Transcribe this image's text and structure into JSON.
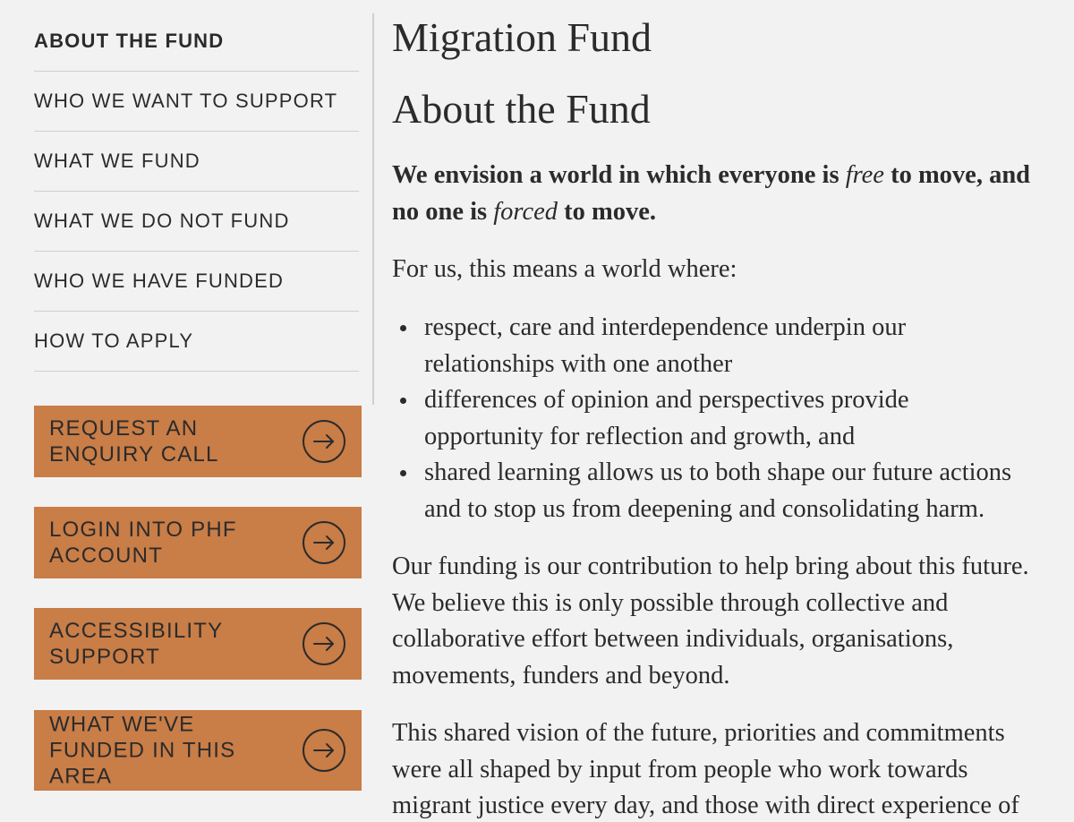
{
  "sidebar": {
    "nav": [
      {
        "label": "ABOUT THE FUND",
        "active": true
      },
      {
        "label": "WHO WE WANT TO SUPPORT"
      },
      {
        "label": "WHAT WE FUND"
      },
      {
        "label": "WHAT WE DO NOT FUND"
      },
      {
        "label": "WHO WE HAVE FUNDED"
      },
      {
        "label": "HOW TO APPLY"
      }
    ],
    "cta": [
      {
        "lines": [
          "REQUEST AN",
          "ENQUIRY CALL"
        ],
        "icon": "arrow-right-circle-icon"
      },
      {
        "lines": [
          "LOGIN INTO PHF",
          "ACCOUNT"
        ],
        "icon": "arrow-right-circle-icon"
      },
      {
        "lines": [
          "ACCESSIBILITY",
          "SUPPORT"
        ],
        "icon": "arrow-right-circle-icon"
      },
      {
        "lines": [
          "WHAT WE'VE",
          "FUNDED IN THIS",
          "AREA"
        ],
        "icon": "arrow-right-circle-icon"
      }
    ]
  },
  "main": {
    "page_title": "Migration Fund",
    "section_title": "About the Fund",
    "vision": {
      "line1_a": "We envision a world in which everyone is ",
      "line1_em": "free",
      "line1_b": " to move, and",
      "line2_a": "no one is ",
      "line2_em": "forced",
      "line2_b": " to move."
    },
    "intro": "For us, this means a world where:",
    "bullets": [
      [
        "respect, care and interdependence underpin our",
        "relationships with one another"
      ],
      [
        "differences of opinion and perspectives provide",
        "opportunity for reflection and growth, and"
      ],
      [
        "shared learning allows us to both shape our future actions",
        "and to stop us from deepening and consolidating harm."
      ]
    ],
    "paragraph1": [
      "Our funding is our contribution to help bring about this future.",
      "We believe this is only possible through collective and",
      "collaborative effort between individuals, organisations,",
      "movements, funders and beyond."
    ],
    "paragraph2": [
      "This shared vision of the future, priorities and commitments",
      "were all shaped by input from people who work towards",
      "migrant justice every day, and those with direct experience of"
    ]
  },
  "colors": {
    "background": "#f2f2f2",
    "cta_background": "#c97d47",
    "text": "#2b2b2b",
    "divider": "#cfcfcf"
  }
}
